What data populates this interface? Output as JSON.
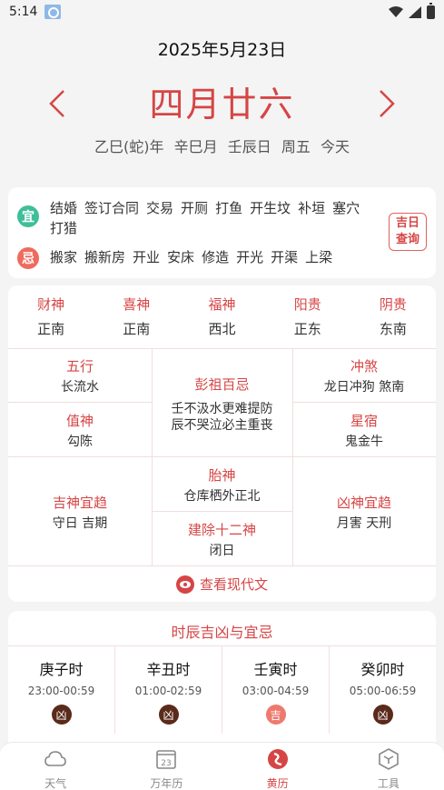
{
  "status": {
    "time": "5:14"
  },
  "header": {
    "date": "2025年5月23日",
    "lunar_date": "四月廿六",
    "ganzhi": [
      "乙巳(蛇)年",
      "辛巳月",
      "壬辰日",
      "周五",
      "今天"
    ]
  },
  "yiji": {
    "yi_label": "宜",
    "ji_label": "忌",
    "yi_items": [
      "结婚",
      "签订合同",
      "交易",
      "开厕",
      "打鱼",
      "开生坟",
      "补垣",
      "塞穴",
      "打猎"
    ],
    "ji_items": [
      "搬家",
      "搬新房",
      "开业",
      "安床",
      "修造",
      "开光",
      "开渠",
      "上梁"
    ],
    "jiri_button": [
      "吉日",
      "查询"
    ]
  },
  "gods": [
    {
      "name": "财神",
      "direction": "正南"
    },
    {
      "name": "喜神",
      "direction": "正南"
    },
    {
      "name": "福神",
      "direction": "西北"
    },
    {
      "name": "阳贵",
      "direction": "正东"
    },
    {
      "name": "阴贵",
      "direction": "东南"
    }
  ],
  "details": {
    "wuxing": {
      "label": "五行",
      "value": "长流水"
    },
    "pengzu": {
      "label": "彭祖百忌",
      "value_line1": "壬不汲水更难提防",
      "value_line2": "辰不哭泣必主重丧"
    },
    "chongsha": {
      "label": "冲煞",
      "value": "龙日冲狗 煞南"
    },
    "zhishen": {
      "label": "值神",
      "value": "勾陈"
    },
    "xingxiu": {
      "label": "星宿",
      "value": "鬼金牛"
    },
    "jishen": {
      "label": "吉神宜趋",
      "value": "守日 吉期"
    },
    "taishen": {
      "label": "胎神",
      "value": "仓库栖外正北"
    },
    "jianchu": {
      "label": "建除十二神",
      "value": "闭日"
    },
    "xiongshen": {
      "label": "凶神宜趋",
      "value": "月害 天刑"
    }
  },
  "modern_link": "查看现代文",
  "shichen": {
    "title": "时辰吉凶与宜忌",
    "items": [
      {
        "name": "庚子时",
        "time": "23:00-00:59",
        "verdict": "凶"
      },
      {
        "name": "辛丑时",
        "time": "01:00-02:59",
        "verdict": "凶"
      },
      {
        "name": "壬寅时",
        "time": "03:00-04:59",
        "verdict": "吉"
      },
      {
        "name": "癸卯时",
        "time": "05:00-06:59",
        "verdict": "凶"
      }
    ]
  },
  "nav": {
    "weather": "天气",
    "calendar": "万年历",
    "calendar_day": "23",
    "almanac": "黄历",
    "tools": "工具",
    "active_color": "#d64545"
  }
}
